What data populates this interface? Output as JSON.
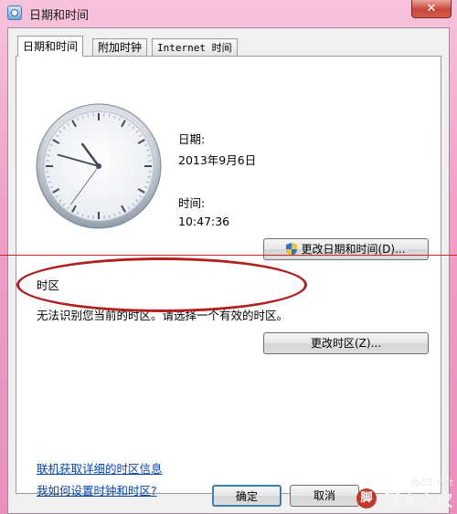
{
  "window": {
    "title": "日期和时间",
    "close_glyph": "✕"
  },
  "tabs": [
    {
      "label": "日期和时间",
      "active": true
    },
    {
      "label": "附加时钟",
      "active": false
    },
    {
      "label": "Internet 时间",
      "active": false
    }
  ],
  "clock": {
    "hour": 10,
    "minute": 47,
    "second": 36
  },
  "date": {
    "label": "日期:",
    "value": "2013年9月6日"
  },
  "time": {
    "label": "时间:",
    "value": "10:47:36"
  },
  "buttons": {
    "change_datetime": "更改日期和时间(D)...",
    "change_timezone": "更改时区(Z)...",
    "ok": "确定",
    "cancel": "取消"
  },
  "timezone": {
    "section_label": "时区",
    "message": "无法识别您当前的时区。请选择一个有效的时区。"
  },
  "links": {
    "online_info": "联机获取详细的时区信息",
    "how_to_set": "我如何设置时钟和时区?"
  },
  "watermark": {
    "url": "jb51.net",
    "name": "脚本之家",
    "badge": "脚"
  },
  "colors": {
    "annotation_red": "#b01e1e",
    "link_blue": "#0645ad",
    "title_pink": "#eea0c8"
  }
}
